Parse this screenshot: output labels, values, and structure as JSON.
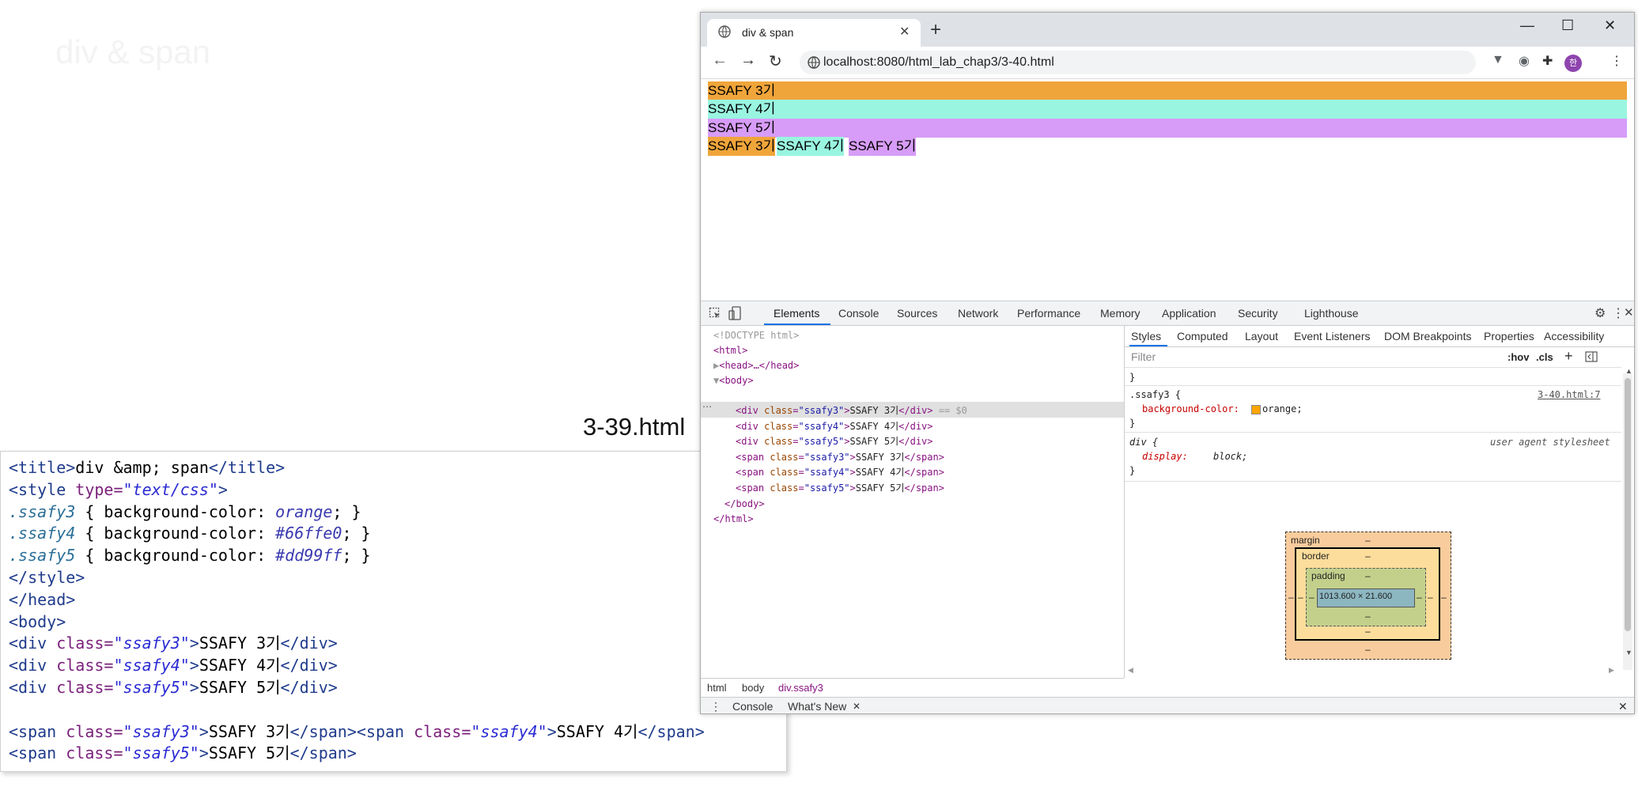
{
  "slide": {
    "ghost_title": "div & span",
    "label": "3-39.html"
  },
  "code_lines": [
    "<title>div &amp; span</title>",
    "<style type=\"text/css\">",
    ".ssafy3 { background-color: orange; }",
    ".ssafy4 { background-color: #66ffe0; }",
    ".ssafy5 { background-color: #dd99ff; }",
    "</style>",
    "</head>",
    "<body>",
    "<div class=\"ssafy3\">SSAFY 3기</div>",
    "<div class=\"ssafy4\">SSAFY 4기</div>",
    "<div class=\"ssafy5\">SSAFY 5기</div>",
    "",
    "<span class=\"ssafy3\">SSAFY 3기</span><span class=\"ssafy4\">SSAFY 4기</span>",
    "<span class=\"ssafy5\">SSAFY 5기</span>"
  ],
  "browser": {
    "tab_title": "div & span",
    "tab_close": "✕",
    "new_tab": "+",
    "minimize": "—",
    "maximize": "☐",
    "close": "✕",
    "url": "localhost:8080/html_lab_chap3/3-40.html",
    "avatar_letter": "한"
  },
  "page": {
    "blocks": [
      {
        "text": "SSAFY 3기",
        "color": "#f0a53a"
      },
      {
        "text": "SSAFY 4기",
        "color": "#99f5e0"
      },
      {
        "text": "SSAFY 5기",
        "color": "#d79cf7"
      }
    ],
    "inline": [
      {
        "text": "SSAFY 3기",
        "color": "#f0a53a"
      },
      {
        "text": "SSAFY 4기",
        "color": "#99f5e0"
      },
      {
        "text": "SSAFY 5기",
        "color": "#d79cf7"
      }
    ]
  },
  "devtools": {
    "tabs": [
      "Elements",
      "Console",
      "Sources",
      "Network",
      "Performance",
      "Memory",
      "Application",
      "Security",
      "Lighthouse"
    ],
    "dom": {
      "doctype": "<!DOCTYPE html>",
      "html_open": "<html>",
      "head": "<head>…</head>",
      "body_open": "<body>",
      "body_close": "</body>",
      "html_close": "</html>",
      "selected_marker": "== $0",
      "children": [
        {
          "tag": "div",
          "cls": "ssafy3",
          "text": "SSAFY 3기"
        },
        {
          "tag": "div",
          "cls": "ssafy4",
          "text": "SSAFY 4기"
        },
        {
          "tag": "div",
          "cls": "ssafy5",
          "text": "SSAFY 5기"
        },
        {
          "tag": "span",
          "cls": "ssafy3",
          "text": "SSAFY 3기"
        },
        {
          "tag": "span",
          "cls": "ssafy4",
          "text": "SSAFY 4기"
        },
        {
          "tag": "span",
          "cls": "ssafy5",
          "text": "SSAFY 5기"
        }
      ]
    },
    "styles_tabs": [
      "Styles",
      "Computed",
      "Layout",
      "Event Listeners",
      "DOM Breakpoints",
      "Properties",
      "Accessibility"
    ],
    "filter_placeholder": "Filter",
    "hov": ":hov",
    "cls": ".cls",
    "plus": "+",
    "rules": {
      "brace_close": "}",
      "rule1_selector": ".ssafy3 {",
      "rule1_source": "3-40.html:7",
      "rule1_prop": "background-color:",
      "rule1_value": "orange;",
      "rule2_selector": "div {",
      "rule2_source": "user agent stylesheet",
      "rule2_prop": "display:",
      "rule2_value": "block;"
    },
    "box_model": {
      "margin_label": "margin",
      "border_label": "border",
      "padding_label": "padding",
      "dash": "–",
      "content_size": "1013.600 × 21.600"
    },
    "breadcrumbs": [
      "html",
      "body",
      "div.ssafy3"
    ],
    "drawer": [
      "Console",
      "What's New"
    ],
    "drawer_close": "✕"
  }
}
